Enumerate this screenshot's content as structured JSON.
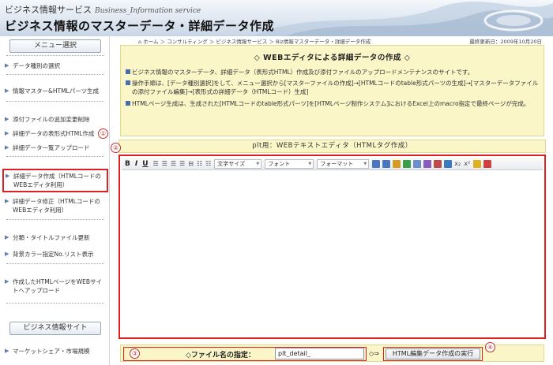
{
  "header": {
    "subtitle": "ビジネス情報サービス",
    "subtitle_en": "Business_Information service",
    "title": "ビジネス情報のマスターデータ・詳細データ作成"
  },
  "sidebar": {
    "menu_button": "メニュー選択",
    "items": [
      {
        "label": "データ種別の選択"
      },
      {
        "label": "情報マスター&HTMLパーツ生成"
      },
      {
        "label": "添付ファイルの追加変更削除"
      },
      {
        "label": "詳細データの表形式HTML作成"
      },
      {
        "label": "詳細データ一覧アップロード"
      },
      {
        "label": "詳細データ作成（HTMLコードのWEBエディタ利用）",
        "active": true,
        "marker": "①"
      },
      {
        "label": "詳細データ修正（HTMLコードのWEBエディタ利用）"
      },
      {
        "label": "分類・タイトルファイル更新"
      },
      {
        "label": "背景カラー指定No.リスト表示"
      },
      {
        "label": "作成したHTMLページをWEBサイトへアップロード"
      }
    ],
    "site_button": "ビジネス情報サイト",
    "site_link": "マーケットシェア・市場規模"
  },
  "breadcrumb": "ホーム ＞ コンサルティング ＞ ビジネス情報サービス ＞ Biz情報マスターデータ・詳細データ作成",
  "updated": "最終更新日：2009年10月20日",
  "info": {
    "heading": "◇ WEBエディタによる詳細データの作成 ◇",
    "lines": [
      "ビジネス情報のマスターデータ、詳細データ（表形式HTML）作成及び添付ファイルのアップロードメンテナンスのサイトです。",
      "操作手順は、[データ種別選択]をして、メニュー選択から[マスターファイルの作成]→[HTMLコードのtable形式パーツの生成]→[マスターデータファイルの添付ファイル編集]→[表形式の詳細データ（HTMLコード）生成]",
      "HTMLページ生成は、生成された[HTMLコードのtable形式パーツ]を[HTMLページ制作システム]におけるExcel上のmacro指定で最終ページが完成。"
    ]
  },
  "editor": {
    "title": "plt用：WEBテキストエディタ（HTMLタグ作成）",
    "marker": "②",
    "toolbar": {
      "bold": "B",
      "italic": "I",
      "underline": "U",
      "fontsize": "文字サイズ",
      "font": "フォント",
      "format": "フォーマット"
    }
  },
  "bottom": {
    "marker_left": "③",
    "label": "◇ファイル名の指定：",
    "filename_value": "plt_detail_",
    "arrow": "◇⇒",
    "run_button": "HTML編集データ作成の実行",
    "marker_right": "④"
  }
}
